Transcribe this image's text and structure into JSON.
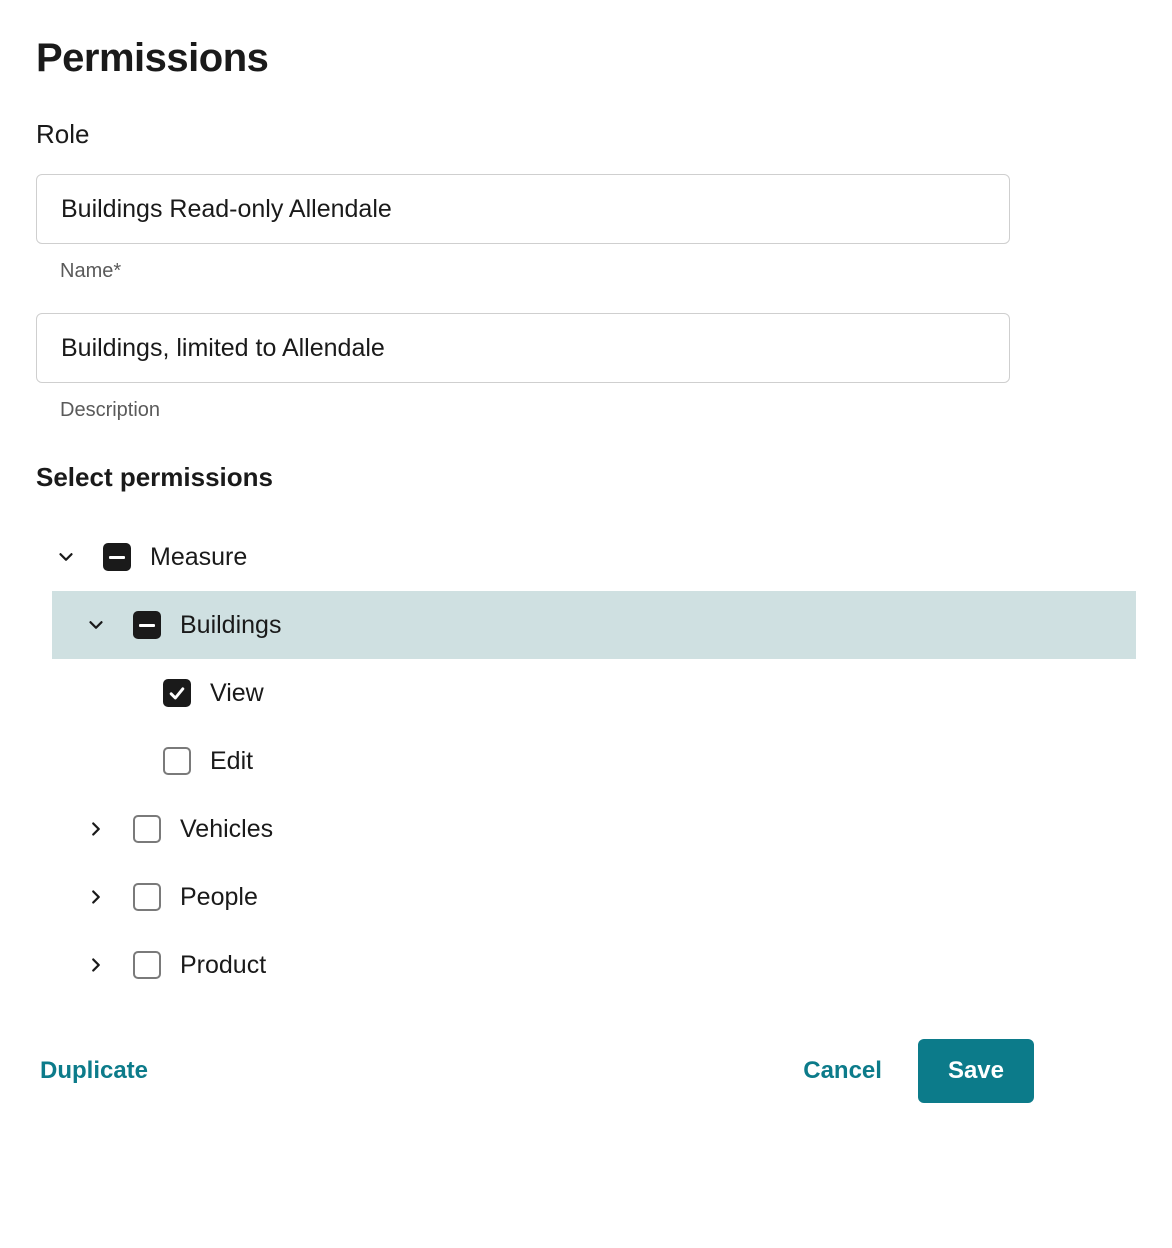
{
  "header": {
    "title": "Permissions"
  },
  "role": {
    "section_label": "Role",
    "name_value": "Buildings Read-only Allendale",
    "name_helper": "Name*",
    "description_value": "Buildings, limited to Allendale",
    "description_helper": "Description"
  },
  "permissions": {
    "section_label": "Select permissions",
    "tree": {
      "measure": {
        "label": "Measure",
        "expanded": true,
        "state": "indeterminate",
        "children": {
          "buildings": {
            "label": "Buildings",
            "expanded": true,
            "state": "indeterminate",
            "highlighted": true,
            "children": {
              "view": {
                "label": "View",
                "state": "checked"
              },
              "edit": {
                "label": "Edit",
                "state": "unchecked"
              }
            }
          },
          "vehicles": {
            "label": "Vehicles",
            "expanded": false,
            "state": "unchecked"
          },
          "people": {
            "label": "People",
            "expanded": false,
            "state": "unchecked"
          },
          "product": {
            "label": "Product",
            "expanded": false,
            "state": "unchecked"
          }
        }
      }
    }
  },
  "footer": {
    "duplicate": "Duplicate",
    "cancel": "Cancel",
    "save": "Save"
  }
}
